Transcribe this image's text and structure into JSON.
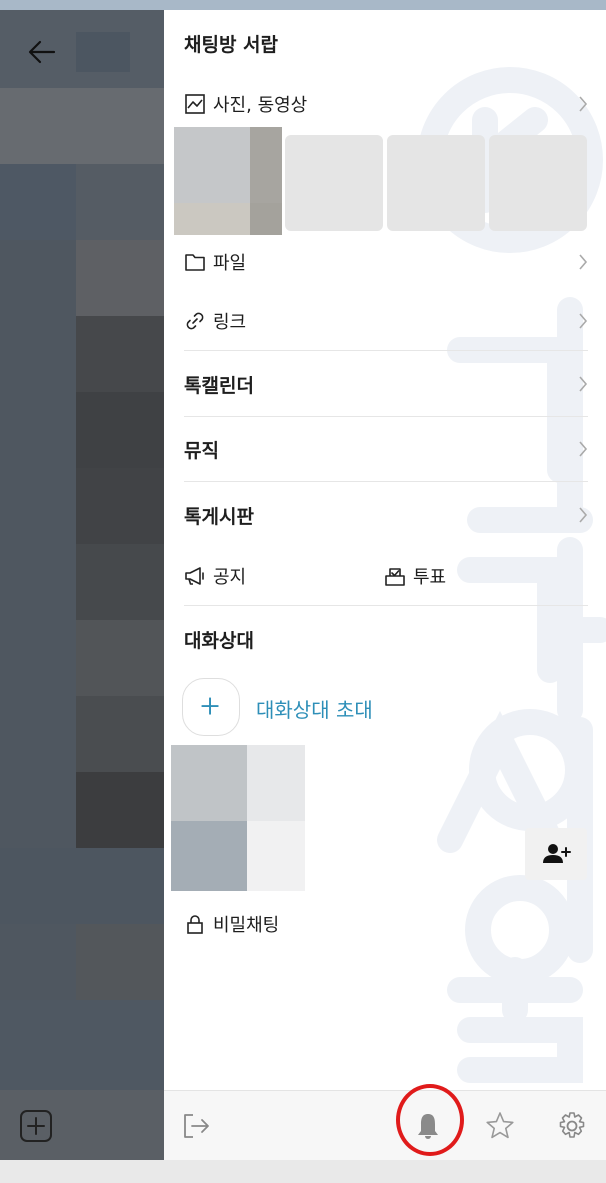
{
  "drawer": {
    "title": "채팅방 서랍",
    "photos_label": "사진, 동영상",
    "files_label": "파일",
    "links_label": "링크",
    "calendar_label": "톡캘린더",
    "music_label": "뮤직",
    "board_label": "톡게시판",
    "notice_label": "공지",
    "vote_label": "투표"
  },
  "participants": {
    "heading": "대화상대",
    "invite_label": "대화상대 초대",
    "secret_chat_label": "비밀채팅"
  },
  "bottom_bar": {
    "icons": [
      "exit-icon",
      "bell-icon",
      "star-icon",
      "gear-icon"
    ],
    "highlighted": "bell-icon"
  },
  "colors": {
    "accent_link": "#2e8fb8",
    "highlight_ring": "#e01b1b",
    "dim_overlay": "#4f5760"
  }
}
